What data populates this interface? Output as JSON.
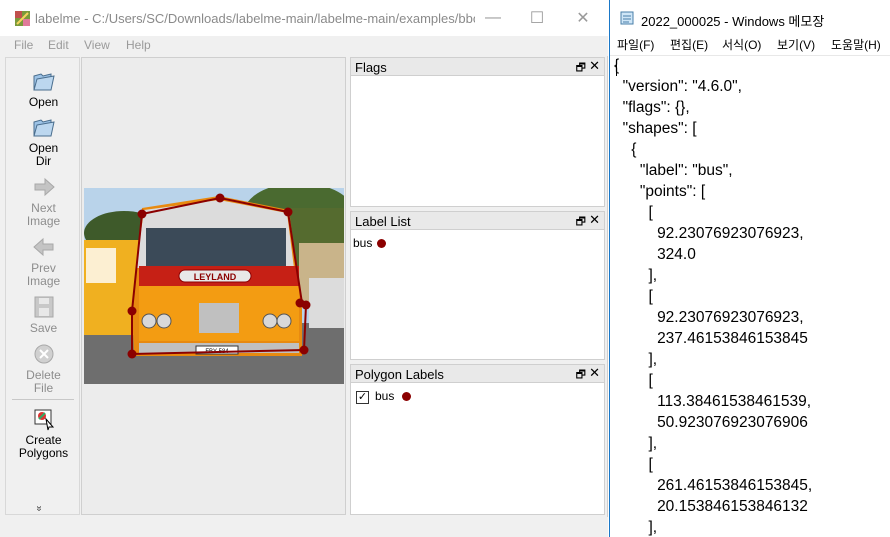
{
  "labelme": {
    "title": "labelme - C:/Users/SC/Downloads/labelme-main/labelme-main/examples/bbo...",
    "window_buttons": {
      "minimize": "—",
      "maximize": "☐",
      "close": "✕"
    },
    "menu": [
      "File",
      "Edit",
      "View",
      "Help"
    ],
    "tools": [
      {
        "label1": "Open",
        "label2": "",
        "icon": "folder-open-icon",
        "enabled": true
      },
      {
        "label1": "Open",
        "label2": "Dir",
        "icon": "folder-open-icon",
        "enabled": true
      },
      {
        "label1": "Next",
        "label2": "Image",
        "icon": "arrow-right-icon",
        "enabled": false
      },
      {
        "label1": "Prev",
        "label2": "Image",
        "icon": "arrow-left-icon",
        "enabled": false
      },
      {
        "label1": "Save",
        "label2": "",
        "icon": "save-icon",
        "enabled": false
      },
      {
        "label1": "Delete",
        "label2": "File",
        "icon": "delete-icon",
        "enabled": false
      },
      {
        "label1": "Create",
        "label2": "Polygons",
        "icon": "create-polygon-icon",
        "enabled": true
      }
    ],
    "more_glyph": "»",
    "docks": {
      "flags": {
        "title": "Flags"
      },
      "label_list": {
        "title": "Label List",
        "items": [
          {
            "label": "bus",
            "color": "#8b0000"
          }
        ]
      },
      "polygon_labels": {
        "title": "Polygon Labels",
        "items": [
          {
            "label": "bus",
            "checked": true,
            "color": "#8b0000"
          }
        ]
      },
      "float_glyph": "🗗",
      "close_glyph": "✕"
    },
    "polygon_color": "#8b0000",
    "image_plate_text": "FBY 584",
    "image_brand_text": "LEYLAND"
  },
  "notepad": {
    "title": "2022_000025 - Windows 메모장",
    "menu": [
      "파일(F)",
      "편집(E)",
      "서식(O)",
      "보기(V)",
      "도움말(H)"
    ],
    "lines": [
      "{",
      "  \"version\": \"4.6.0\",",
      "  \"flags\": {},",
      "  \"shapes\": [",
      "    {",
      "      \"label\": \"bus\",",
      "      \"points\": [",
      "        [",
      "          92.23076923076923,",
      "          324.0",
      "        ],",
      "        [",
      "          92.23076923076923,",
      "          237.46153846153845",
      "        ],",
      "        [",
      "          113.38461538461539,",
      "          50.923076923076906",
      "        ],",
      "        [",
      "          261.46153846153845,",
      "          20.153846153846132",
      "        ],"
    ]
  }
}
